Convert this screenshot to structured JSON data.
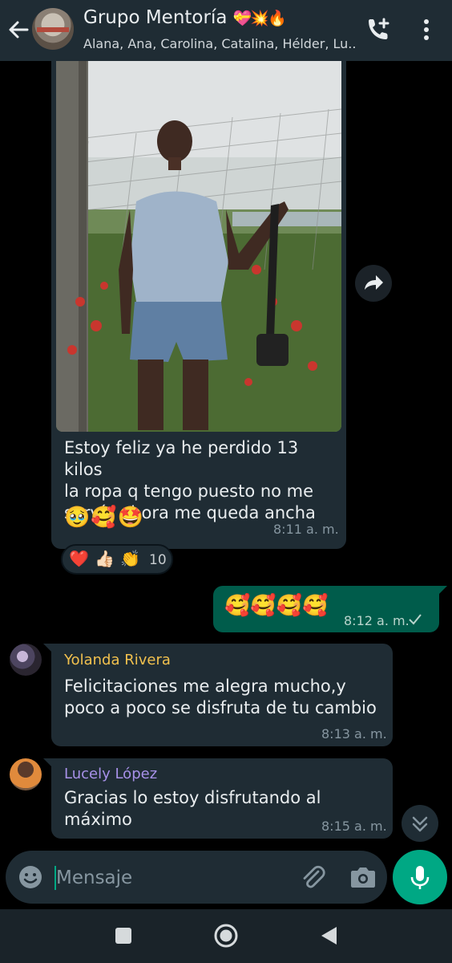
{
  "header": {
    "title": "Grupo Mentoría",
    "title_emojis": "💝💥🔥",
    "members": "Alana, Ana, Carolina, Catalina, Hélder, Lu..."
  },
  "messages": [
    {
      "type": "incoming_image",
      "text_lines": [
        "Estoy feliz ya he perdido 13 kilos",
        "la ropa q tengo puesto no me",
        "servía ahora me queda ancha"
      ],
      "emojis": "🥹🥰🤩",
      "time": "8:11 a. m.",
      "reactions": {
        "emojis": [
          "❤️",
          "👍🏻",
          "👏"
        ],
        "count": "10"
      }
    },
    {
      "type": "outgoing",
      "emojis": "🥰🥰🥰🥰",
      "time": "8:12 a. m.",
      "status_icon": "single-check-icon"
    },
    {
      "type": "incoming",
      "sender": "Yolanda Rivera",
      "sender_color": "#f2c14e",
      "text_lines": [
        "Felicitaciones me alegra mucho,y",
        "poco a poco se disfruta de  tu cambio"
      ],
      "time": "8:13 a. m."
    },
    {
      "type": "incoming",
      "sender": "Lucely López",
      "sender_color": "#a791e8",
      "text_lines": [
        "Gracias lo estoy disfrutando al",
        "máximo"
      ],
      "time": "8:15 a. m."
    }
  ],
  "input": {
    "placeholder": "Mensaje"
  },
  "colors": {
    "header_bg": "#1f2c34",
    "incoming_bubble": "#1f2c34",
    "outgoing_bubble": "#005c4b",
    "accent": "#00a884",
    "chat_bg": "#000000"
  }
}
